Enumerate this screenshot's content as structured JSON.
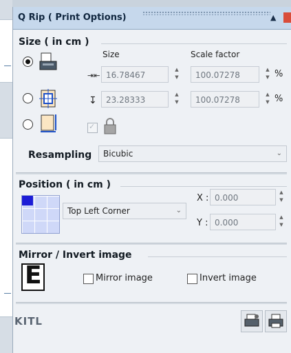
{
  "window": {
    "title": "Q Rip ( Print Options)"
  },
  "size": {
    "heading": "Size ( in cm )",
    "col_size": "Size",
    "col_scale": "Scale factor",
    "width_value": "16.78467",
    "height_value": "23.28333",
    "scale_x": "100.07278",
    "scale_y": "100.07278",
    "percent": "%",
    "resampling_label": "Resampling",
    "resampling_value": "Bicubic"
  },
  "position": {
    "heading": "Position ( in cm )",
    "anchor_value": "Top Left Corner",
    "x_label": "X :",
    "y_label": "Y :",
    "x_value": "0.000",
    "y_value": "0.000"
  },
  "mirror": {
    "heading": "Mirror / Invert image",
    "mirror_label": "Mirror image",
    "invert_label": "Invert image",
    "preview_letter": "E"
  },
  "footer": {
    "brand": "KITL"
  }
}
